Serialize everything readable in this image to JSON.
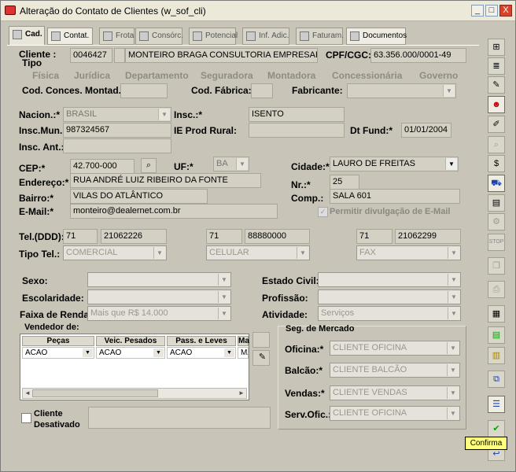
{
  "window": {
    "title": "Alteração do Contato de Clientes (w_sof_cli)",
    "min": "_",
    "max": "□",
    "close": "X"
  },
  "tabs": [
    "Cad.",
    "Contat.",
    "Frota",
    "Consórc.",
    "Potencial",
    "Inf. Adic.",
    "Faturam.",
    "Documentos"
  ],
  "labels": {
    "cliente": "Cliente :",
    "tipo": "Tipo",
    "cpf": "CPF/CGC:*",
    "cod_conces": "Cod. Conces. Montad.:",
    "cod_fabrica": "Cod. Fábrica:",
    "fabricante": "Fabricante:",
    "nacion": "Nacion.:*",
    "insc": "Insc.:*",
    "insc_mun": "Insc.Mun.:*",
    "ie_prod": "IE Prod Rural:",
    "dt_fund": "Dt Fund:*",
    "insc_ant": "Insc. Ant.:",
    "cep": "CEP:*",
    "uf": "UF:*",
    "cidade": "Cidade:*",
    "endereco": "Endereço:*",
    "nr": "Nr.:*",
    "bairro": "Bairro:*",
    "comp": "Comp.:",
    "email": "E-Mail:*",
    "permitir": "Permitir divulgação de E-Mail",
    "tel": "Tel.(DDD):",
    "tipo_tel": "Tipo Tel.:",
    "sexo": "Sexo:",
    "estado_civil": "Estado Civil:",
    "escolaridade": "Escolaridade:",
    "profissao": "Profissão:",
    "faixa": "Faixa de Renda:",
    "atividade": "Atividade:",
    "vendedor": "Vendedor de:",
    "seg": "Seg. de Mercado",
    "oficina": "Oficina:*",
    "balcao": "Balcão:*",
    "vendas": "Vendas:*",
    "serv_ofic": "Serv.Ofic.:",
    "cliente_desativado": "Cliente\nDesativado"
  },
  "tipos": [
    "Física",
    "Jurídica",
    "Departamento",
    "Seguradora",
    "Montadora",
    "Concessionária",
    "Governo"
  ],
  "values": {
    "cliente_cod": "0046427",
    "cliente_nome": "MONTEIRO BRAGA CONSULTORIA EMPRESARIAL LT",
    "cpf": "63.356.000/0001-49",
    "nacion": "BRASIL",
    "insc": "ISENTO",
    "insc_mun": "987324567",
    "dt_fund": "01/01/2004",
    "cep": "42.700-000",
    "uf": "BA",
    "cidade": "LAURO DE FREITAS",
    "endereco": "RUA ANDRÉ LUIZ RIBEIRO DA FONTE",
    "nr": "25",
    "bairro": "VILAS DO ATLÂNTICO",
    "comp": "SALA 601",
    "email": "monteiro@dealernet.com.br",
    "faixa": "Mais que R$ 14.000",
    "atividade": "Serviços"
  },
  "phones": [
    {
      "ddd": "71",
      "num": "21062226",
      "tipo": "COMERCIAL"
    },
    {
      "ddd": "71",
      "num": "88880000",
      "tipo": "CELULAR"
    },
    {
      "ddd": "71",
      "num": "21062299",
      "tipo": "FAX"
    }
  ],
  "grid": {
    "headers": [
      "Peças",
      "Veic. Pesados",
      "Pass. e Leves",
      "Ma"
    ],
    "row": [
      "ACAO",
      "ACAO",
      "ACAO",
      "MA"
    ]
  },
  "seg": {
    "oficina": "CLIENTE OFICINA",
    "balcao": "CLIENTE BALCÃO",
    "vendas": "CLIENTE VENDAS",
    "serv_ofic": "CLIENTE OFICINA"
  },
  "tooltip": "Confirma"
}
